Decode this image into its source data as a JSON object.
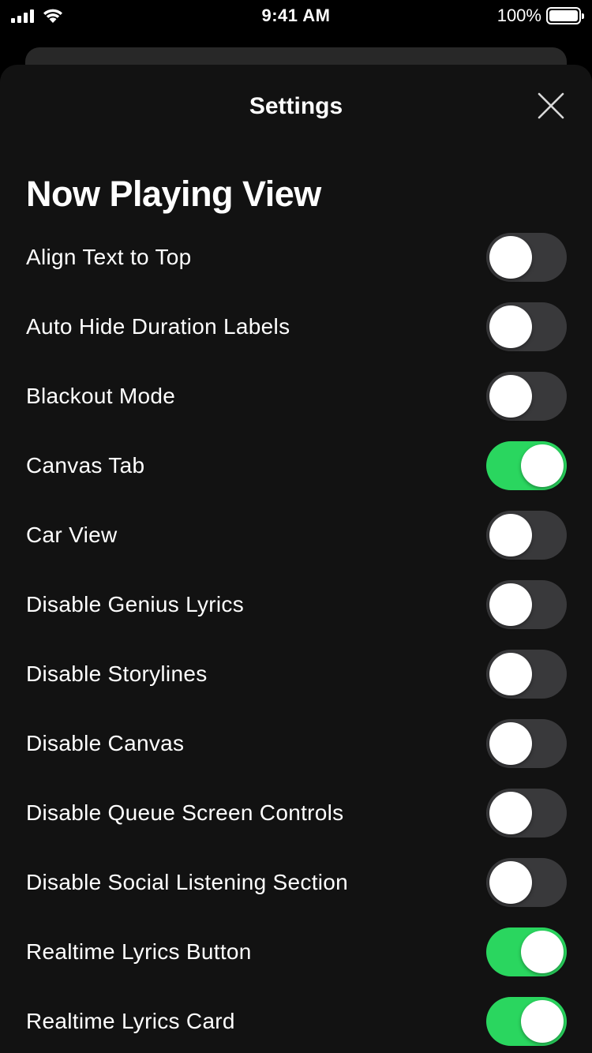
{
  "status_bar": {
    "time": "9:41 AM",
    "battery_percent": "100%",
    "icons": [
      "signal-icon",
      "wifi-icon",
      "battery-icon"
    ]
  },
  "sheet": {
    "title": "Settings",
    "close_icon": "close-icon"
  },
  "section": {
    "title": "Now Playing View"
  },
  "settings": [
    {
      "label": "Align Text to Top",
      "on": false
    },
    {
      "label": "Auto Hide Duration Labels",
      "on": false
    },
    {
      "label": "Blackout Mode",
      "on": false
    },
    {
      "label": "Canvas Tab",
      "on": true
    },
    {
      "label": "Car View",
      "on": false
    },
    {
      "label": "Disable Genius Lyrics",
      "on": false
    },
    {
      "label": "Disable Storylines",
      "on": false
    },
    {
      "label": "Disable Canvas",
      "on": false
    },
    {
      "label": "Disable Queue Screen Controls",
      "on": false
    },
    {
      "label": "Disable Social Listening Section",
      "on": false
    },
    {
      "label": "Realtime Lyrics Button",
      "on": true
    },
    {
      "label": "Realtime Lyrics Card",
      "on": true
    }
  ],
  "colors": {
    "background": "#121212",
    "toggle_on": "#2ad65f",
    "toggle_off": "#39393b",
    "text": "#ffffff"
  }
}
